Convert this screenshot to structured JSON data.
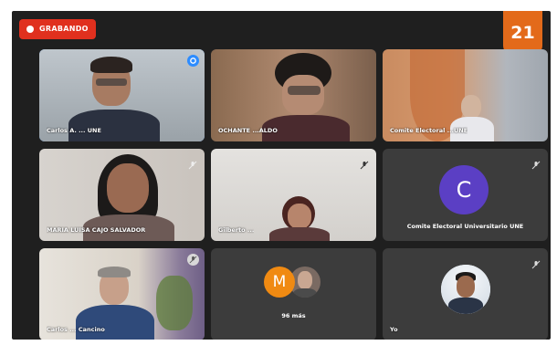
{
  "recording": {
    "label": "GRABANDO"
  },
  "participant_count": "21",
  "tiles": [
    {
      "name": "Carlos A. ... UNE"
    },
    {
      "name": "OCHANTE ...ALDO"
    },
    {
      "name": "Comite Electoral ...UNE"
    },
    {
      "name": "MARIA LUISA CAJO SALVADOR"
    },
    {
      "name": "Gilberto ..."
    },
    {
      "avatar_letter": "C",
      "name": "Comite Electoral Universitario UNE"
    },
    {
      "name": "Carlos ... Cancino"
    },
    {
      "avatar_letter": "M",
      "more_label": "96 más"
    },
    {
      "name": "Yo"
    }
  ],
  "colors": {
    "background": "#1f1f1f",
    "tile": "#3c3c3c",
    "active_border": "#2d8cff",
    "recording": "#e0301e",
    "counter": "#e36a1a",
    "avatar_c": "#5b3fc4",
    "avatar_m": "#f08a12"
  }
}
